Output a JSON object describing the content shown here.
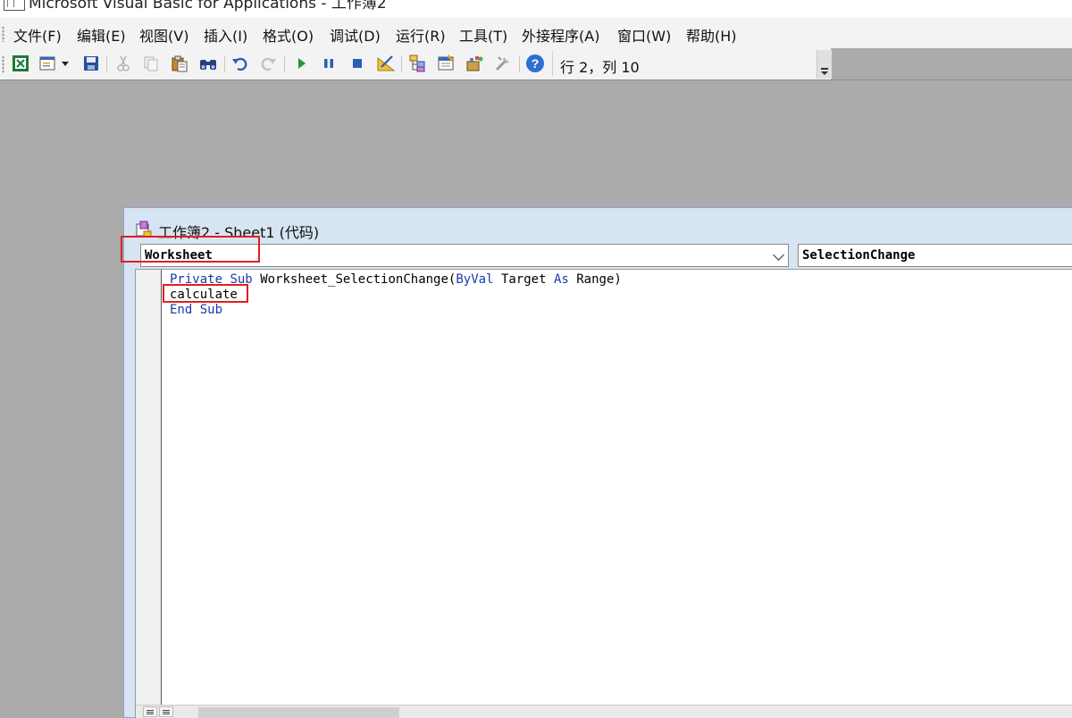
{
  "app": {
    "title": "Microsoft Visual Basic for Applications - 工作簿2"
  },
  "menu": {
    "items": [
      {
        "label": "文件(F)"
      },
      {
        "label": "编辑(E)"
      },
      {
        "label": "视图(V)"
      },
      {
        "label": "插入(I)"
      },
      {
        "label": "格式(O)"
      },
      {
        "label": "调试(D)"
      },
      {
        "label": "运行(R)"
      },
      {
        "label": "工具(T)"
      },
      {
        "label": "外接程序(A)"
      },
      {
        "label": "窗口(W)"
      },
      {
        "label": "帮助(H)"
      }
    ]
  },
  "toolbar": {
    "icons": [
      "view-excel-icon",
      "insert-module-icon",
      "save-icon",
      "cut-icon",
      "copy-icon",
      "paste-icon",
      "find-icon",
      "undo-icon",
      "redo-icon",
      "run-icon",
      "break-icon",
      "reset-icon",
      "design-mode-icon",
      "project-explorer-icon",
      "properties-icon",
      "object-browser-icon",
      "toolbox-icon",
      "help-icon"
    ],
    "status": "行 2，列 10"
  },
  "code_window": {
    "title": "工作簿2 - Sheet1 (代码)",
    "object_combo": "Worksheet",
    "procedure_combo": "SelectionChange",
    "code": {
      "line1": {
        "kw1": "Private",
        "kw2": "Sub",
        "text1": "Worksheet_SelectionChange(",
        "kw3": "ByVal",
        "text2": "Target",
        "kw4": "As",
        "text3": "Range)"
      },
      "line2": "calculate",
      "line3": {
        "kw1": "End",
        "kw2": "Sub"
      }
    }
  },
  "colors": {
    "highlight": "#e02020",
    "keyword": "#1a3aa8"
  }
}
